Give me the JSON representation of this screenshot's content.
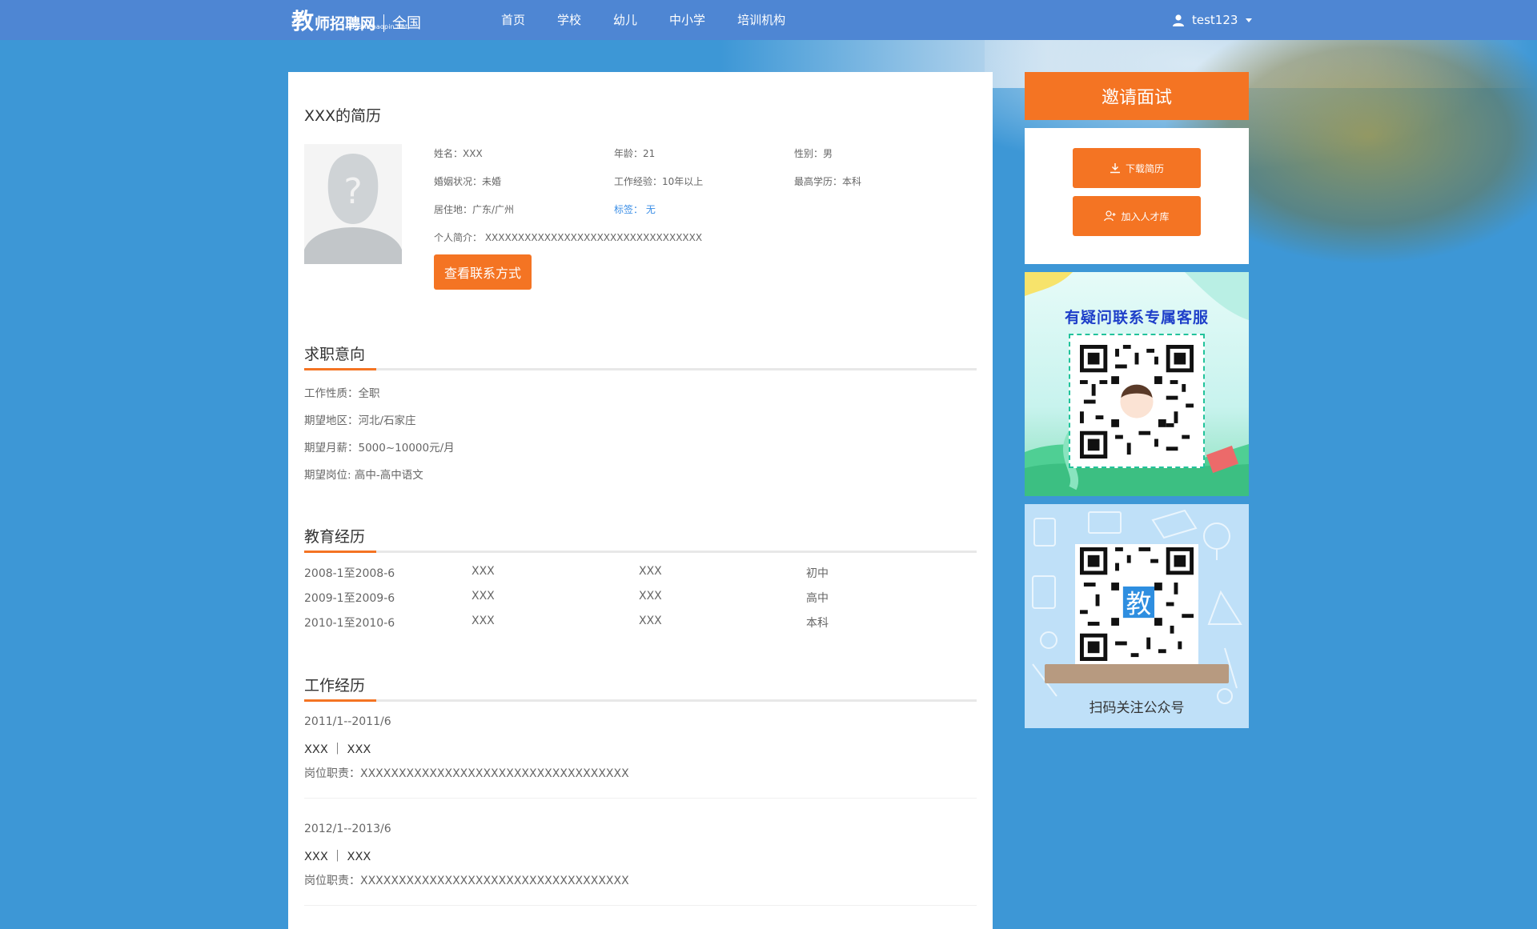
{
  "header": {
    "logo_mark": "教",
    "logo_text": "师招聘网",
    "logo_domain": "jiaoshizhaopin.net",
    "city": "全国",
    "nav": [
      "首页",
      "学校",
      "幼儿",
      "中小学",
      "培训机构"
    ],
    "username": "test123"
  },
  "resume": {
    "title": "XXX的简历",
    "info": {
      "name": "姓名：XXX",
      "age": "年龄：21",
      "gender": "性别：男",
      "marital": "婚姻状况：未婚",
      "experience": "工作经验：10年以上",
      "education": "最高学历：本科",
      "location": "居住地：广东/广州",
      "tag": "标签： 无",
      "intro": "个人简介： XXXXXXXXXXXXXXXXXXXXXXXXXXXXXXXXX"
    },
    "contact_button": "查看联系方式"
  },
  "intention": {
    "title": "求职意向",
    "items": [
      "工作性质：全职",
      "期望地区：河北/石家庄",
      "期望月薪：5000~10000元/月",
      "期望岗位: 高中-高中语文"
    ]
  },
  "education": {
    "title": "教育经历",
    "rows": [
      [
        "2008-1至2008-6",
        "XXX",
        "XXX",
        "初中"
      ],
      [
        "2009-1至2009-6",
        "XXX",
        "XXX",
        "高中"
      ],
      [
        "2010-1至2010-6",
        "XXX",
        "XXX",
        "本科"
      ]
    ]
  },
  "work": {
    "title": "工作经历",
    "jobs": [
      {
        "date": "2011/1--2011/6",
        "company": "XXX ｜ XXX",
        "duty": "岗位职责：XXXXXXXXXXXXXXXXXXXXXXXXXXXXXXXXXXX"
      },
      {
        "date": "2012/1--2013/6",
        "company": "XXX ｜ XXX",
        "duty": "岗位职责：XXXXXXXXXXXXXXXXXXXXXXXXXXXXXXXXXXX"
      }
    ]
  },
  "sidebar": {
    "invite_title": "邀请面试",
    "download_label": "下载简历",
    "add_talent_label": "加入人才库",
    "promo1_title": "有疑问联系专属客服",
    "promo2_caption": "扫码关注公众号"
  },
  "colors": {
    "header": "#4e86d3",
    "accent_orange": "#f47423",
    "page_bg": "#3d97d6",
    "link_blue": "#3a8ee6"
  },
  "icons": [
    "user-icon",
    "download-icon",
    "add-user-icon",
    "avatar-placeholder-icon",
    "qr-code-icon"
  ]
}
